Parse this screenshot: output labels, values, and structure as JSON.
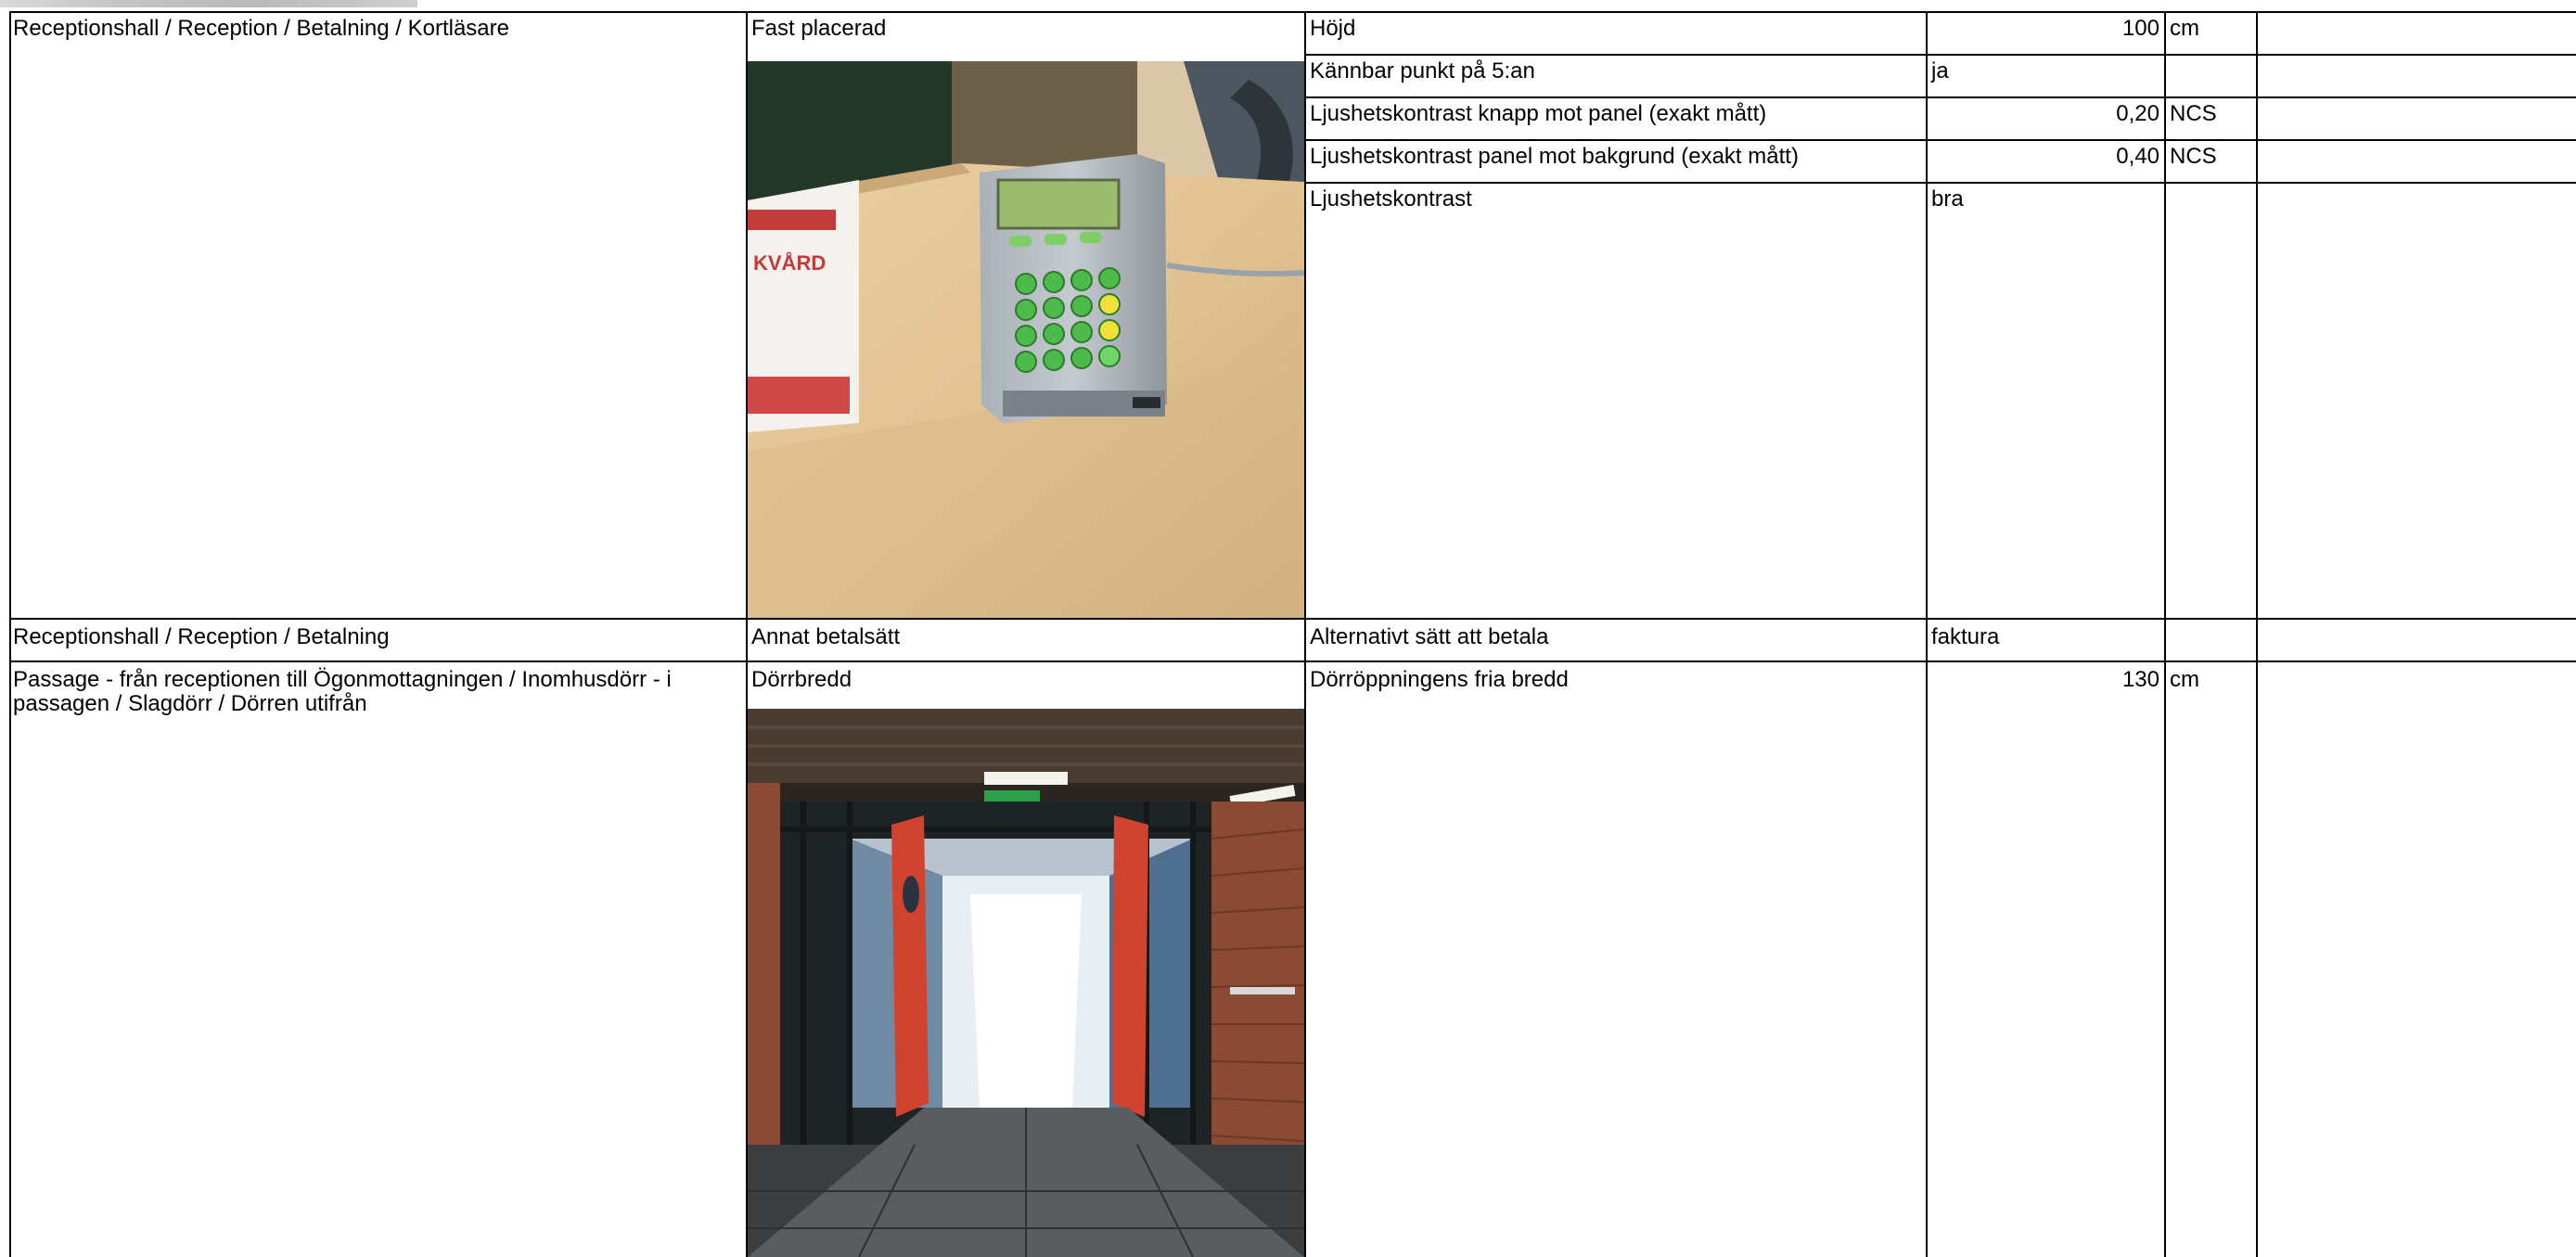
{
  "rows": [
    {
      "location": "Receptionshall / Reception / Betalning / Kortläsare",
      "item": "Fast placerad",
      "photo": "photo-card-reader",
      "measures": [
        {
          "label": "Höjd",
          "value": "100",
          "unit": "cm"
        },
        {
          "label": "Kännbar punkt på 5:an",
          "value": "ja",
          "unit": ""
        },
        {
          "label": "Ljushetskontrast knapp mot panel (exakt mått)",
          "value": "0,20",
          "unit": "NCS"
        },
        {
          "label": "Ljushetskontrast panel mot bakgrund (exakt mått)",
          "value": "0,40",
          "unit": "NCS"
        },
        {
          "label": "Ljushetskontrast",
          "value": "bra",
          "unit": ""
        }
      ]
    },
    {
      "location": "Receptionshall / Reception / Betalning",
      "item": "Annat betalsätt",
      "measures": [
        {
          "label": "Alternativt sätt att betala",
          "value": "faktura",
          "unit": ""
        }
      ]
    },
    {
      "location": "Passage - från receptionen till Ögonmottagningen / Inomhusdörr - i passagen / Slagdörr / Dörren utifrån",
      "item": "Dörrbredd",
      "photo": "photo-door-passage",
      "measures": [
        {
          "label": "Dörröppningens fria bredd",
          "value": "130",
          "unit": "cm"
        }
      ]
    }
  ],
  "colors": {
    "grid": "#000000",
    "background": "#ffffff"
  }
}
